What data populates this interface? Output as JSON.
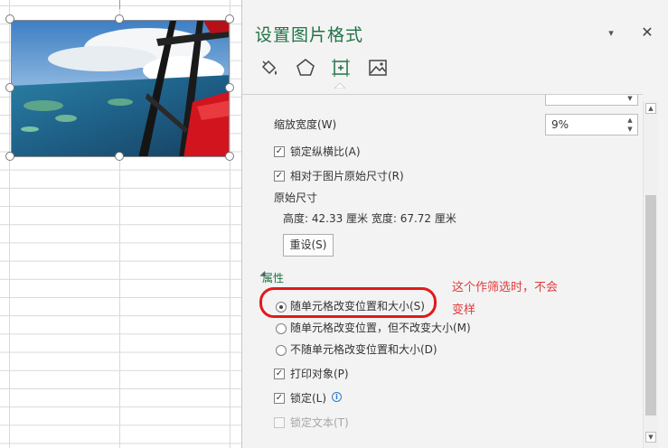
{
  "panel": {
    "title": "设置图片格式",
    "menu_glyph": "▾",
    "close_glyph": "✕",
    "tabs": [
      {
        "name": "fill-line",
        "icon": "paint-bucket-icon"
      },
      {
        "name": "effects",
        "icon": "pentagon-icon"
      },
      {
        "name": "size-properties",
        "icon": "size-properties-icon",
        "active": true
      },
      {
        "name": "picture",
        "icon": "picture-icon"
      }
    ]
  },
  "size": {
    "scale_width_label": "缩放宽度(W)",
    "scale_width_value": "9%",
    "lock_aspect_label": "锁定纵横比(A)",
    "lock_aspect_checked": true,
    "relative_original_label": "相对于图片原始尺寸(R)",
    "relative_original_checked": true,
    "original_size_label": "原始尺寸",
    "original_size_text": "高度:  42.33 厘米    宽度:  67.72 厘米",
    "reset_label": "重设(S)"
  },
  "properties": {
    "title": "属性",
    "radios": [
      {
        "label": "随单元格改变位置和大小(S)",
        "selected": true
      },
      {
        "label": "随单元格改变位置，但不改变大小(M)",
        "selected": false
      },
      {
        "label": "不随单元格改变位置和大小(D)",
        "selected": false
      }
    ],
    "print_object_label": "打印对象(P)",
    "print_object_checked": true,
    "locked_label": "锁定(L)",
    "locked_checked": true,
    "lock_text_label": "锁定文本(T)",
    "lock_text_checked": false
  },
  "annotation": {
    "line1": "这个作筛选时，不会",
    "line2": "变样"
  },
  "colors": {
    "accent_green": "#217346",
    "annotation_red": "#e11a1a",
    "panel_bg": "#f3f3f3"
  }
}
